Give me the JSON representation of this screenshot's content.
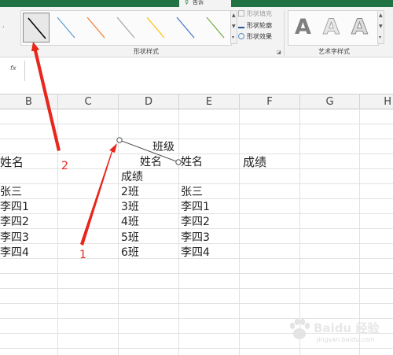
{
  "ribbon": {
    "active_tab_label": "告诉",
    "left_fragment": "·",
    "shape_styles": {
      "group_label": "形状样式",
      "styles": [
        {
          "name": "black-line",
          "color": "#000000"
        },
        {
          "name": "blue-line",
          "color": "#5b9bd5"
        },
        {
          "name": "orange-line",
          "color": "#ed7d31"
        },
        {
          "name": "gray-line",
          "color": "#a5a5a5"
        },
        {
          "name": "gold-line",
          "color": "#ffc000"
        },
        {
          "name": "blue-line-2",
          "color": "#4472c4"
        },
        {
          "name": "green-line",
          "color": "#70ad47"
        }
      ]
    },
    "shape_fill_label": "形状填充",
    "shape_outline_label": "形状轮廓",
    "shape_effects_label": "形状效果",
    "wordart": {
      "group_label": "艺术字样式",
      "letters": [
        "A",
        "A",
        "A"
      ]
    }
  },
  "formula_bar": {
    "fx_label": "fx",
    "value": ""
  },
  "columns": [
    "B",
    "C",
    "D",
    "E",
    "F",
    "G",
    "H"
  ],
  "cells": {
    "header_banji": "班级",
    "header_xingming_b": "姓名",
    "header_xingming_d": "姓名",
    "header_xingming_e": "姓名",
    "header_chengji_f": "成绩",
    "header_chengji_d": "成绩",
    "rows": [
      {
        "b": "张三",
        "d": "2班",
        "e": "张三"
      },
      {
        "b": "李四1",
        "d": "3班",
        "e": "李四1"
      },
      {
        "b": "李四2",
        "d": "4班",
        "e": "李四2"
      },
      {
        "b": "李四3",
        "d": "5班",
        "e": "李四3"
      },
      {
        "b": "李四4",
        "d": "6班",
        "e": "李四4"
      }
    ]
  },
  "annotations": {
    "arrow_1_label": "1",
    "arrow_2_label": "2",
    "color": "#e8261c"
  },
  "watermark": {
    "text": "Baidu 经验",
    "sub": "jingyan.baidu.com"
  }
}
